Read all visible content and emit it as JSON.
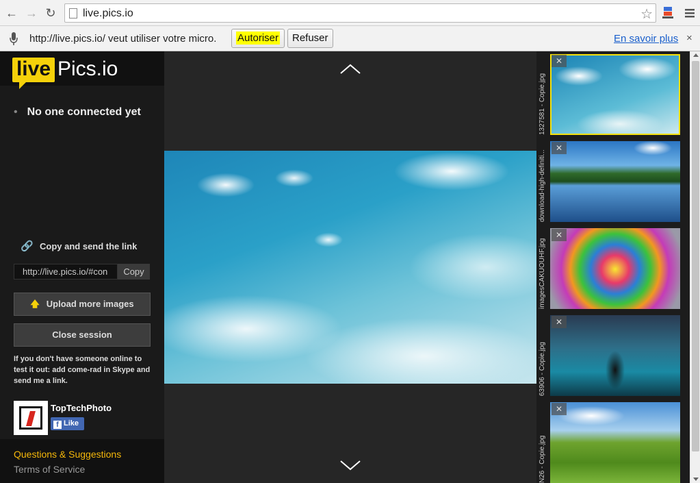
{
  "browser": {
    "url": "live.pics.io",
    "infobar_message": "http://live.pics.io/ veut utiliser votre micro.",
    "allow_label": "Autoriser",
    "deny_label": "Refuser",
    "learn_more_label": "En savoir plus",
    "close_glyph": "×"
  },
  "sidebar": {
    "logo_live": "live",
    "logo_pics": "Pics.io",
    "connection_status": "No one connected yet",
    "copy_link_label": "Copy and send the link",
    "link_value": "http://live.pics.io/#con",
    "copy_button": "Copy",
    "upload_button": "Upload more images",
    "close_session_button": "Close session",
    "hint": "If you don't have someone online to test it out: add come-rad in Skype and send me a link.",
    "brand_name": "TopTechPhoto",
    "like_label": "Like",
    "questions_link": "Questions & Suggestions",
    "terms_link": "Terms of Service"
  },
  "thumbnails": [
    {
      "name": "1327581 - Copie.jpg",
      "selected": true
    },
    {
      "name": "download-high-definiti...",
      "selected": false
    },
    {
      "name": "imagesCAKUOUHF.jpg",
      "selected": false
    },
    {
      "name": "63906 - Copie.jpg",
      "selected": false
    },
    {
      "name": "N26 - Copie.jpg",
      "selected": false
    }
  ],
  "colors": {
    "accent_yellow": "#f5d10a",
    "link_orange": "#f5b80a",
    "facebook_blue": "#4267b2"
  }
}
